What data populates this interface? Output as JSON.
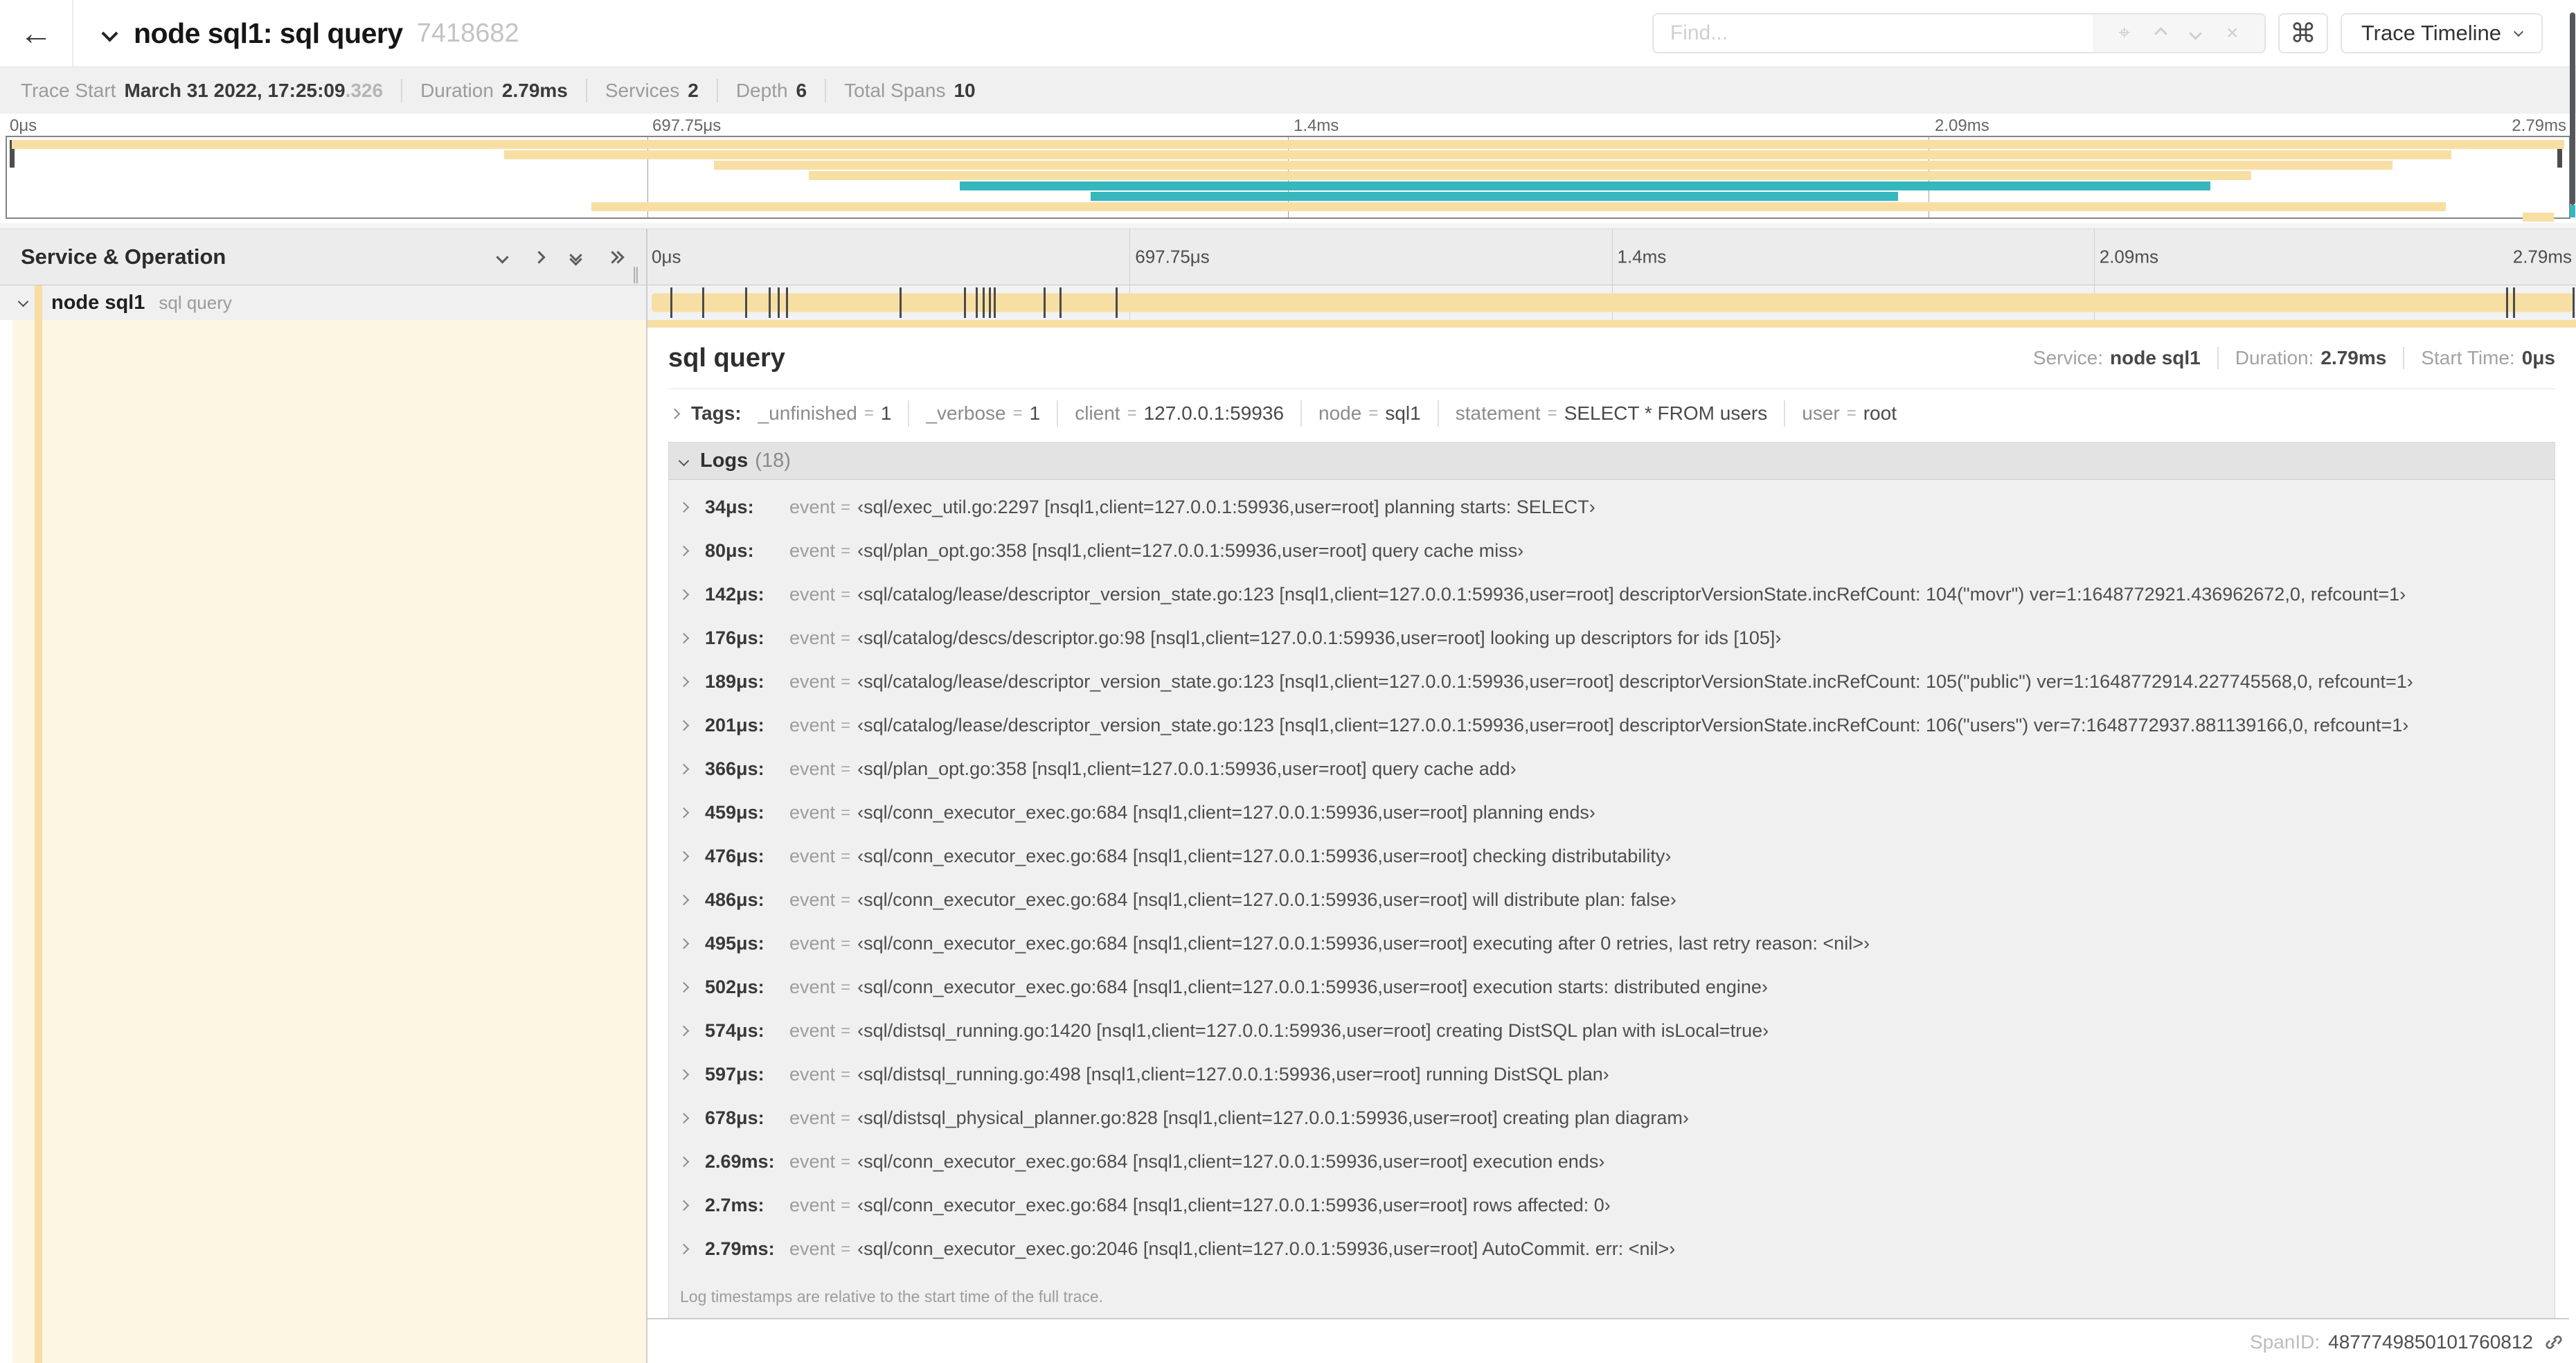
{
  "header": {
    "back_icon": "←",
    "title": "node sql1: sql query",
    "trace_id_short": "7418682",
    "find_placeholder": "Find...",
    "keyboard_shortcut_icon": "⌘",
    "view_selector_label": "Trace Timeline"
  },
  "summary": {
    "items": [
      {
        "label": "Trace Start",
        "value": "March 31 2022, 17:25:09",
        "suffix": ".326"
      },
      {
        "label": "Duration",
        "value": "2.79ms"
      },
      {
        "label": "Services",
        "value": "2"
      },
      {
        "label": "Depth",
        "value": "6"
      },
      {
        "label": "Total Spans",
        "value": "10"
      }
    ]
  },
  "timeline": {
    "left_header": "Service & Operation",
    "axis_labels": [
      "0μs",
      "697.75μs",
      "1.4ms",
      "2.09ms",
      "2.79ms"
    ],
    "axis_positions": [
      0,
      25,
      50,
      75,
      100
    ],
    "row": {
      "service": "node sql1",
      "operation": "sql query"
    },
    "duration_us": 2790,
    "log_marker_times_us": [
      34,
      80,
      142,
      176,
      189,
      201,
      366,
      459,
      476,
      486,
      495,
      502,
      574,
      597,
      678,
      2690,
      2700,
      2790
    ],
    "minimap_bars": [
      {
        "start": 0.2,
        "end": 99.8,
        "color": "tan"
      },
      {
        "start": 19.4,
        "end": 95.4,
        "color": "tan"
      },
      {
        "start": 27.6,
        "end": 93.1,
        "color": "tan"
      },
      {
        "start": 31.3,
        "end": 87.6,
        "color": "tan"
      },
      {
        "start": 37.2,
        "end": 86.0,
        "color": "teal"
      },
      {
        "start": 42.3,
        "end": 73.8,
        "color": "teal"
      },
      {
        "start": 22.8,
        "end": 95.2,
        "color": "tan"
      },
      {
        "start": 98.2,
        "end": 99.4,
        "color": "tan"
      }
    ]
  },
  "detail": {
    "title": "sql query",
    "service_label": "Service:",
    "service": "node sql1",
    "duration_label": "Duration:",
    "duration": "2.79ms",
    "start_label": "Start Time:",
    "start": "0μs",
    "tags_label": "Tags:",
    "tags": [
      {
        "key": "_unfinished",
        "value": "1"
      },
      {
        "key": "_verbose",
        "value": "1"
      },
      {
        "key": "client",
        "value": "127.0.0.1:59936"
      },
      {
        "key": "node",
        "value": "sql1"
      },
      {
        "key": "statement",
        "value": "SELECT * FROM users"
      },
      {
        "key": "user",
        "value": "root"
      }
    ],
    "logs_label": "Logs",
    "logs_count": "(18)",
    "log_field_name": "event",
    "logs": [
      {
        "time": "34μs:",
        "value": "‹sql/exec_util.go:2297 [nsql1,client=127.0.0.1:59936,user=root] planning starts: SELECT›"
      },
      {
        "time": "80μs:",
        "value": "‹sql/plan_opt.go:358 [nsql1,client=127.0.0.1:59936,user=root] query cache miss›"
      },
      {
        "time": "142μs:",
        "value": "‹sql/catalog/lease/descriptor_version_state.go:123 [nsql1,client=127.0.0.1:59936,user=root] descriptorVersionState.incRefCount: 104(\"movr\") ver=1:1648772921.436962672,0, refcount=1›"
      },
      {
        "time": "176μs:",
        "value": "‹sql/catalog/descs/descriptor.go:98 [nsql1,client=127.0.0.1:59936,user=root] looking up descriptors for ids [105]›"
      },
      {
        "time": "189μs:",
        "value": "‹sql/catalog/lease/descriptor_version_state.go:123 [nsql1,client=127.0.0.1:59936,user=root] descriptorVersionState.incRefCount: 105(\"public\") ver=1:1648772914.227745568,0, refcount=1›"
      },
      {
        "time": "201μs:",
        "value": "‹sql/catalog/lease/descriptor_version_state.go:123 [nsql1,client=127.0.0.1:59936,user=root] descriptorVersionState.incRefCount: 106(\"users\") ver=7:1648772937.881139166,0, refcount=1›"
      },
      {
        "time": "366μs:",
        "value": "‹sql/plan_opt.go:358 [nsql1,client=127.0.0.1:59936,user=root] query cache add›"
      },
      {
        "time": "459μs:",
        "value": "‹sql/conn_executor_exec.go:684 [nsql1,client=127.0.0.1:59936,user=root] planning ends›"
      },
      {
        "time": "476μs:",
        "value": "‹sql/conn_executor_exec.go:684 [nsql1,client=127.0.0.1:59936,user=root] checking distributability›"
      },
      {
        "time": "486μs:",
        "value": "‹sql/conn_executor_exec.go:684 [nsql1,client=127.0.0.1:59936,user=root] will distribute plan: false›"
      },
      {
        "time": "495μs:",
        "value": "‹sql/conn_executor_exec.go:684 [nsql1,client=127.0.0.1:59936,user=root] executing after 0 retries, last retry reason: <nil>›"
      },
      {
        "time": "502μs:",
        "value": "‹sql/conn_executor_exec.go:684 [nsql1,client=127.0.0.1:59936,user=root] execution starts: distributed engine›"
      },
      {
        "time": "574μs:",
        "value": "‹sql/distsql_running.go:1420 [nsql1,client=127.0.0.1:59936,user=root] creating DistSQL plan with isLocal=true›"
      },
      {
        "time": "597μs:",
        "value": "‹sql/distsql_running.go:498 [nsql1,client=127.0.0.1:59936,user=root] running DistSQL plan›"
      },
      {
        "time": "678μs:",
        "value": "‹sql/distsql_physical_planner.go:828 [nsql1,client=127.0.0.1:59936,user=root] creating plan diagram›"
      },
      {
        "time": "2.69ms:",
        "value": "‹sql/conn_executor_exec.go:684 [nsql1,client=127.0.0.1:59936,user=root] execution ends›"
      },
      {
        "time": "2.7ms:",
        "value": "‹sql/conn_executor_exec.go:684 [nsql1,client=127.0.0.1:59936,user=root] rows affected: 0›"
      },
      {
        "time": "2.79ms:",
        "value": "‹sql/conn_executor_exec.go:2046 [nsql1,client=127.0.0.1:59936,user=root] AutoCommit. err: <nil>›"
      }
    ],
    "footnote": "Log timestamps are relative to the start time of the full trace.",
    "spanid_label": "SpanID:",
    "spanid": "4877749850101760812"
  },
  "colors": {
    "span_tan": "#f7dfa4",
    "span_teal": "#36b7bd",
    "detail_cream": "#fdf6e3"
  }
}
